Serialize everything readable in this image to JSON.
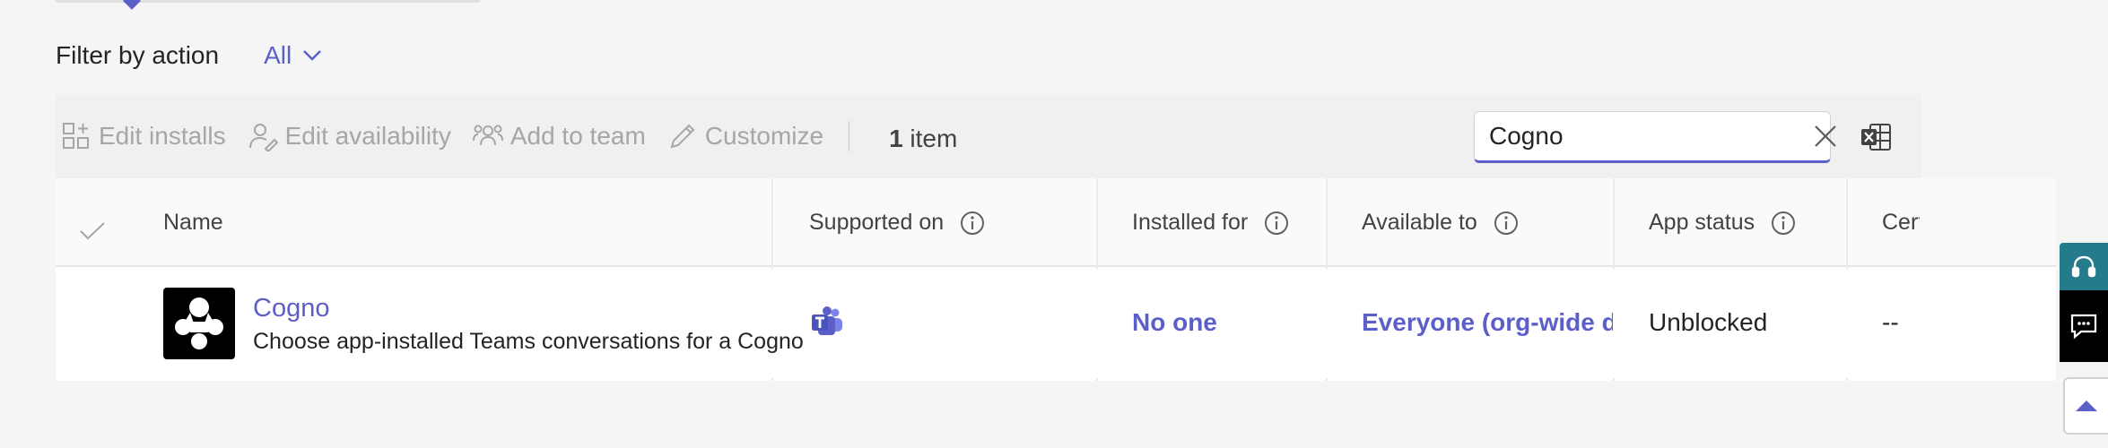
{
  "filter": {
    "label": "Filter by action",
    "value": "All"
  },
  "toolbar": {
    "edit_installs": "Edit installs",
    "edit_availability": "Edit availability",
    "add_to_team": "Add to team",
    "customize": "Customize",
    "count_number": "1",
    "count_unit": " item"
  },
  "search": {
    "value": "Cogno"
  },
  "grid": {
    "columns": {
      "name": "Name",
      "supported_on": "Supported on",
      "installed_for": "Installed for",
      "available_to": "Available to",
      "app_status": "App status",
      "certification": "Cert"
    },
    "rows": [
      {
        "name": "Cogno",
        "description": "Choose app-installed Teams conversations for a Cogno",
        "supported_on_icon": "teams-icon",
        "installed_for": "No one",
        "available_to": "Everyone (org-wide de",
        "app_status": "Unblocked",
        "certification": "--"
      }
    ]
  },
  "colors": {
    "accent": "#5b5fc7",
    "side_strip": "#237b8c"
  }
}
